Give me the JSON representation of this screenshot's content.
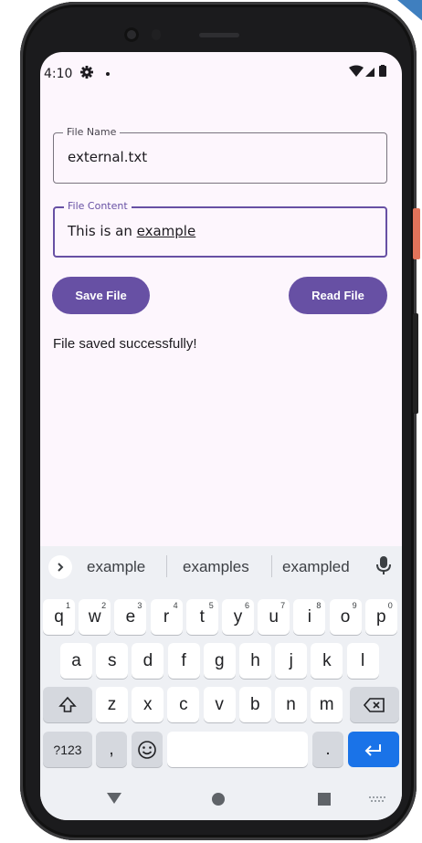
{
  "status_bar": {
    "time": "4:10"
  },
  "form": {
    "file_name": {
      "label": "File Name",
      "value": "external.txt"
    },
    "file_content": {
      "label": "File Content",
      "value_plain": "This is an ",
      "value_underlined": "example"
    }
  },
  "buttons": {
    "save": "Save File",
    "read": "Read File"
  },
  "message": "File saved successfully!",
  "keyboard": {
    "suggestions": [
      "example",
      "examples",
      "exampled"
    ],
    "row1": [
      {
        "k": "q",
        "s": "1"
      },
      {
        "k": "w",
        "s": "2"
      },
      {
        "k": "e",
        "s": "3"
      },
      {
        "k": "r",
        "s": "4"
      },
      {
        "k": "t",
        "s": "5"
      },
      {
        "k": "y",
        "s": "6"
      },
      {
        "k": "u",
        "s": "7"
      },
      {
        "k": "i",
        "s": "8"
      },
      {
        "k": "o",
        "s": "9"
      },
      {
        "k": "p",
        "s": "0"
      }
    ],
    "row2": [
      "a",
      "s",
      "d",
      "f",
      "g",
      "h",
      "j",
      "k",
      "l"
    ],
    "row3": [
      "z",
      "x",
      "c",
      "v",
      "b",
      "n",
      "m"
    ],
    "symbols_key": "?123",
    "comma_key": ",",
    "period_key": "."
  },
  "colors": {
    "primary": "#6750a4",
    "background": "#fdf6fd",
    "enter_key": "#1a73e8"
  }
}
